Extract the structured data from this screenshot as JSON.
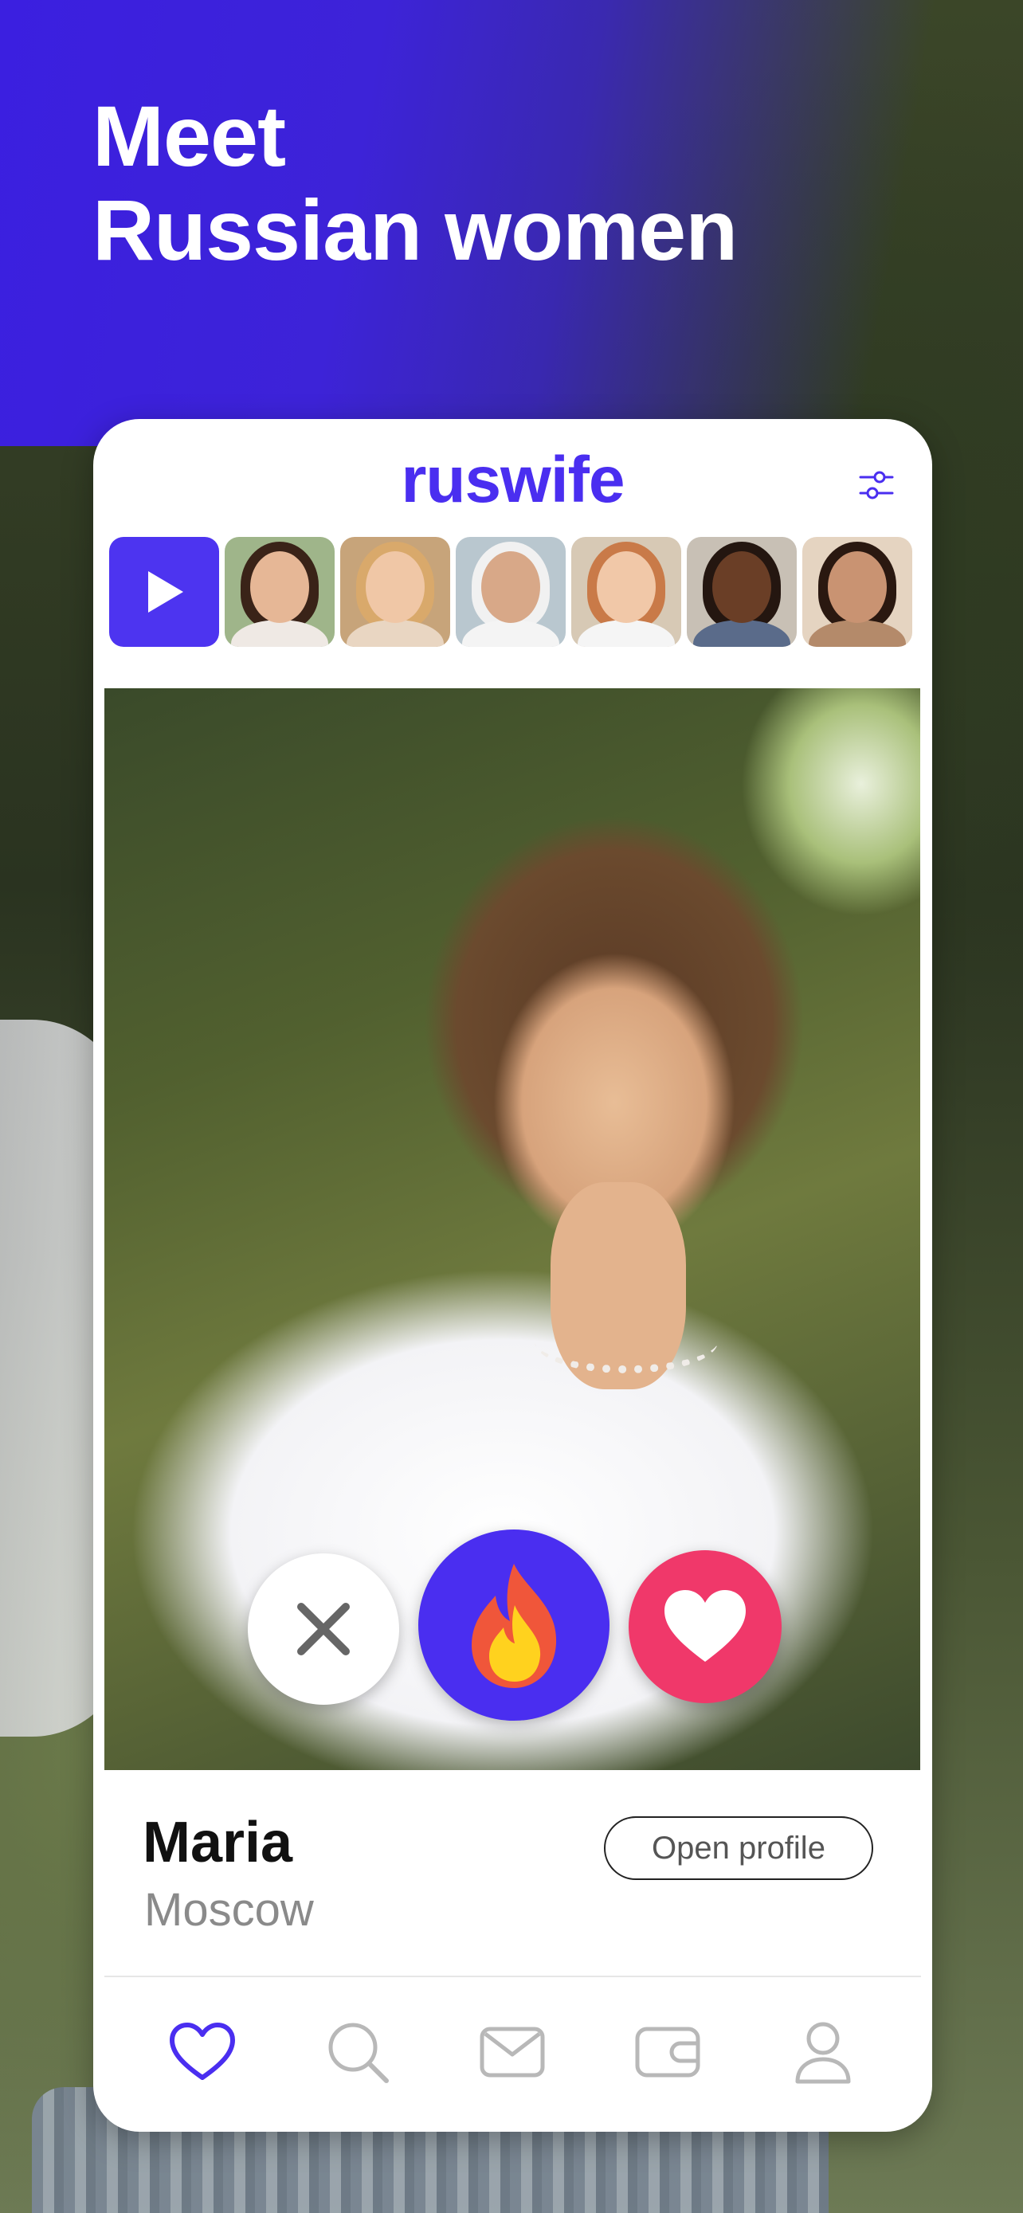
{
  "headline": {
    "line1": "Meet",
    "line2": "Russian women"
  },
  "app": {
    "logo": "ruswife"
  },
  "stories": [
    {
      "type": "video",
      "icon": "play-icon"
    },
    {
      "type": "avatar",
      "skin": "#e6b796",
      "hair": "#3a2318",
      "top": "#efe9e4",
      "bg": "#9fb58a"
    },
    {
      "type": "avatar",
      "skin": "#f0c7a6",
      "hair": "#d9a96b",
      "top": "#e9d6c2",
      "bg": "#c7a47a"
    },
    {
      "type": "avatar",
      "skin": "#d8a888",
      "hair": "#f1f1f1",
      "top": "#f4f4f4",
      "bg": "#b9c7cf"
    },
    {
      "type": "avatar",
      "skin": "#f1c8a8",
      "hair": "#c97a48",
      "top": "#f5f5f5",
      "bg": "#d7c9b5"
    },
    {
      "type": "avatar",
      "skin": "#6a3e26",
      "hair": "#241610",
      "top": "#5a6b8a",
      "bg": "#c8c0b5"
    },
    {
      "type": "avatar",
      "skin": "#c99372",
      "hair": "#2a1810",
      "top": "#b48a6a",
      "bg": "#e5d4c1"
    }
  ],
  "profile": {
    "name": "Maria",
    "city": "Moscow",
    "open_label": "Open profile"
  },
  "actions": [
    {
      "name": "dislike",
      "icon": "close-icon"
    },
    {
      "name": "super-like",
      "icon": "fire-icon"
    },
    {
      "name": "like",
      "icon": "heart-icon"
    }
  ],
  "tabs": [
    {
      "name": "likes",
      "icon": "heart-outline-icon",
      "active": true
    },
    {
      "name": "search",
      "icon": "search-icon",
      "active": false
    },
    {
      "name": "messages",
      "icon": "mail-icon",
      "active": false
    },
    {
      "name": "wallet",
      "icon": "wallet-icon",
      "active": false
    },
    {
      "name": "profile",
      "icon": "user-icon",
      "active": false
    }
  ],
  "colors": {
    "brand": "#4a2ef0",
    "like": "#f0386a",
    "inactive": "#b8b8b8",
    "text": "#111111",
    "muted": "#8a8a8a"
  }
}
